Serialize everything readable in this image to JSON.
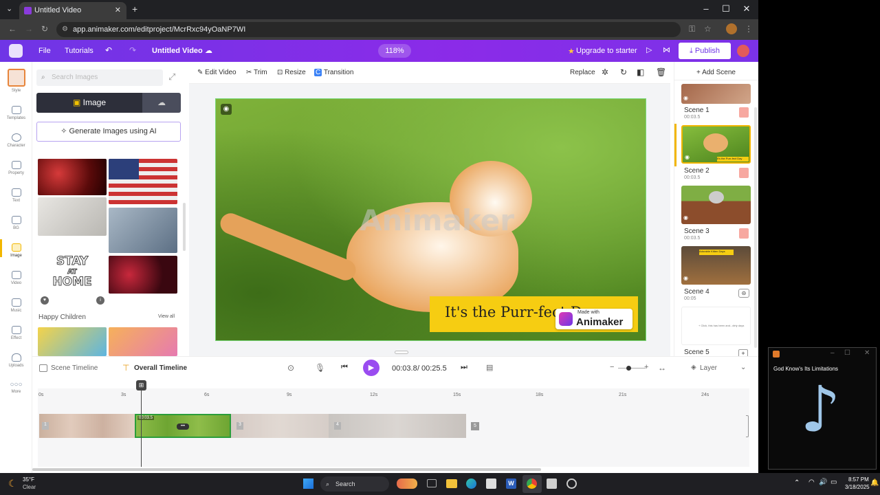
{
  "browser": {
    "tab_title": "Untitled Video",
    "url": "app.animaker.com/editproject/McrRxc94yOaNP7WI"
  },
  "topbar": {
    "file": "File",
    "tutorials": "Tutorials",
    "project_title": "Untitled Video",
    "zoom": "118%",
    "upgrade": "Upgrade to starter",
    "publish": "Publish"
  },
  "rail": [
    "Style",
    "Templates",
    "Character",
    "Property",
    "Text",
    "BG",
    "Image",
    "Video",
    "Music",
    "Effect",
    "Uploads",
    "More"
  ],
  "panel": {
    "search_placeholder": "Search Images",
    "image_tab": "Image",
    "generate": "Generate Images using AI",
    "section2_title": "Happy Children",
    "view_all": "View all",
    "stay_home_1": "STAY",
    "stay_home_2": "AT",
    "stay_home_3": "HOME"
  },
  "editor_toolbar": {
    "edit_video": "Edit Video",
    "trim": "Trim",
    "resize": "Resize",
    "transition": "Transition",
    "replace": "Replace"
  },
  "canvas": {
    "watermark": "Animaker",
    "caption": "It's the Purr-fect Day",
    "made_with": "Made with",
    "brand": "Animaker"
  },
  "scenes": {
    "add_scene": "+ Add Scene",
    "items": [
      {
        "label": "Scene 1",
        "time": "00:03.5"
      },
      {
        "label": "Scene 2",
        "time": "00:03.5",
        "overlay": "It's the Purr-fect Day"
      },
      {
        "label": "Scene 3",
        "time": "00:03.5"
      },
      {
        "label": "Scene 4",
        "time": "00:05",
        "overlay": "Adorable Kitten Days"
      },
      {
        "label": "Scene 5",
        "time": "",
        "overlay": "+ Click, this has been and...dirty days"
      }
    ]
  },
  "timeline": {
    "scene_timeline": "Scene Timeline",
    "overall_timeline": "Overall Timeline",
    "current_time": "00:03.8",
    "separator": "/",
    "total_time": "00:25.5",
    "layer": "Layer",
    "ruler": [
      "0s",
      "3s",
      "6s",
      "9s",
      "12s",
      "15s",
      "18s",
      "21s",
      "24s"
    ],
    "clip_time": "00:03.5",
    "clip_numbers": [
      "1",
      "3",
      "4",
      "5"
    ]
  },
  "media_widget": {
    "title": "God Know's Its Limitations"
  },
  "taskbar": {
    "temp": "35°F",
    "weather": "Clear",
    "search": "Search",
    "time": "8:57 PM",
    "date": "3/18/2025"
  }
}
